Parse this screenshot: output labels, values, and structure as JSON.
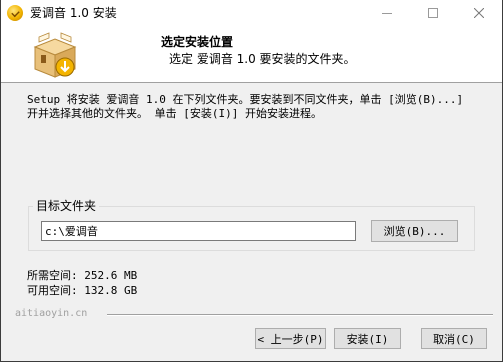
{
  "window": {
    "title": "爱调音 1.0 安装",
    "minimize_glyph": "—",
    "maximize_glyph": "□",
    "close_glyph": "✕"
  },
  "header": {
    "title": "选定安装位置",
    "subtitle": "选定 爱调音 1.0 要安装的文件夹。",
    "icon": "install-box-icon"
  },
  "body": {
    "instruction": "Setup 将安装 爱调音 1.0 在下列文件夹。要安装到不同文件夹，单击 [浏览(B)...]\n开并选择其他的文件夹。 单击 [安装(I)] 开始安装进程。"
  },
  "destination": {
    "group_label": "目标文件夹",
    "path_value": "c:\\爱调音",
    "browse_label": "浏览(B)..."
  },
  "space": {
    "required": "所需空间: 252.6 MB",
    "available": "可用空间: 132.8 GB"
  },
  "footer": {
    "brand": "aitiaoyin.cn",
    "back_label": "< 上一步(P)",
    "install_label": "安装(I)",
    "cancel_label": "取消(C)"
  }
}
